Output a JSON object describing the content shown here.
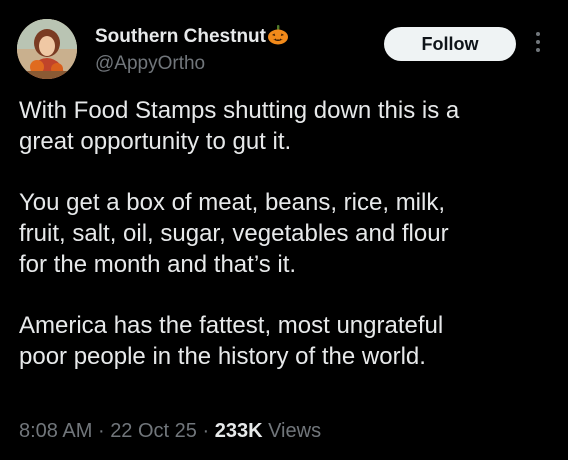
{
  "post": {
    "author": {
      "display_name": "Southern Chestnut",
      "handle": "@AppyOrtho",
      "name_emoji": "pumpkin-icon",
      "avatar": "avatar"
    },
    "follow_label": "Follow",
    "more_icon": "more-options-icon",
    "paragraphs": [
      "With Food Stamps shutting down this is a\ngreat opportunity to gut it.",
      "You get a box of meat, beans, rice, milk,\nfruit, salt, oil, sugar, vegetables and flour\nfor the month and that’s it.",
      "America has the fattest, most ungrateful\npoor people in the history of the world."
    ],
    "meta": {
      "time": "8:08 AM",
      "separator": "·",
      "date": "22 Oct 25",
      "views_count": "233K",
      "views_label": "Views"
    }
  },
  "colors": {
    "background": "#000000",
    "text_primary": "#e7e9ea",
    "text_secondary": "#71767b",
    "follow_button_bg": "#eff3f4",
    "follow_button_text": "#0f1419",
    "pumpkin": "#f28a1a"
  }
}
